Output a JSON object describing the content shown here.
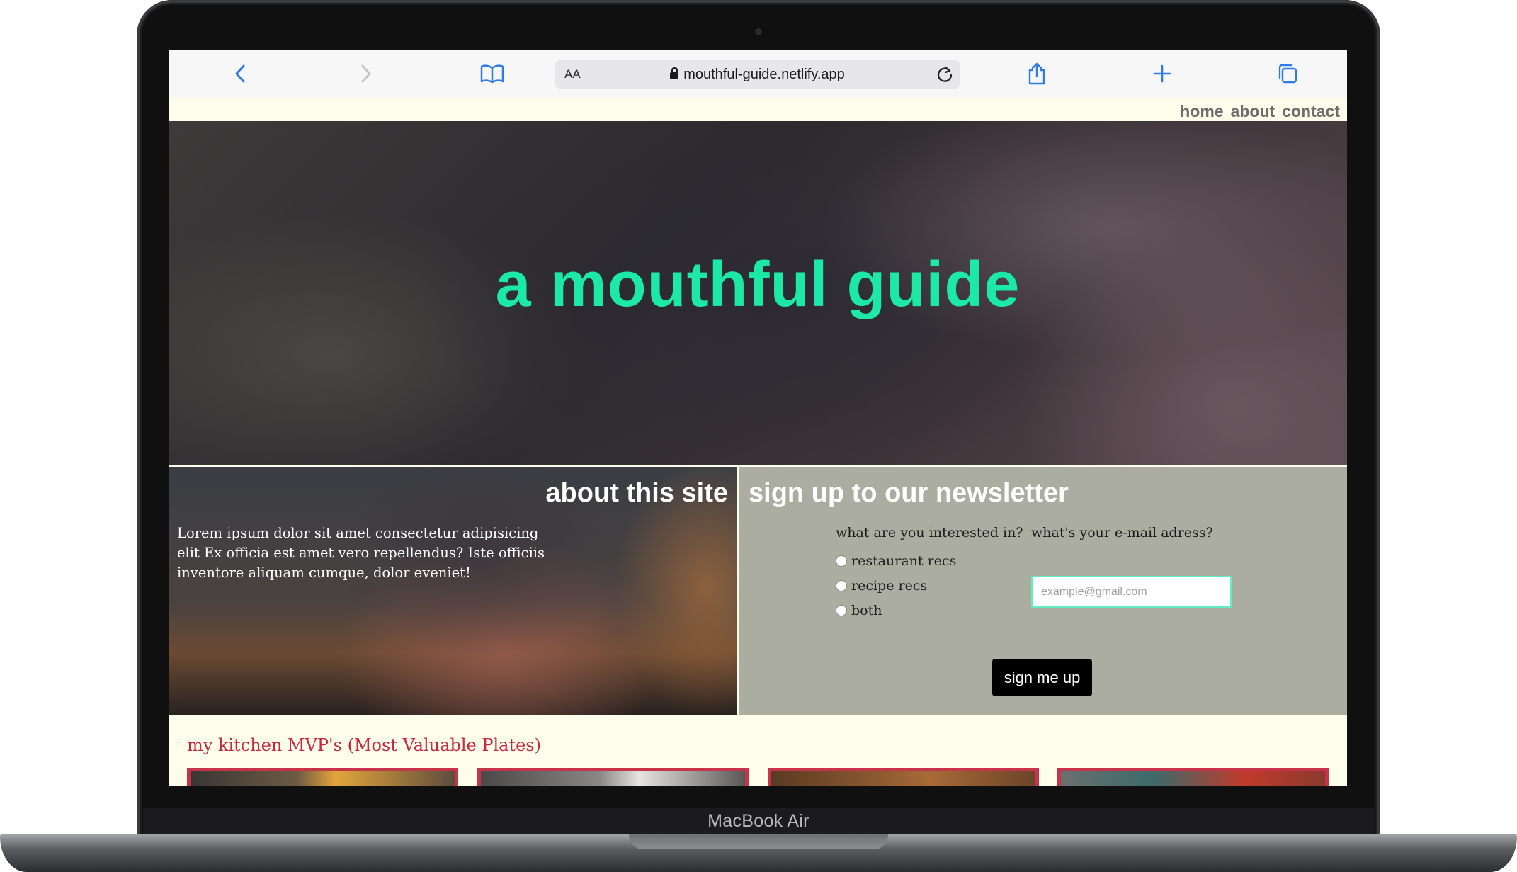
{
  "device": {
    "label": "MacBook Air"
  },
  "browser": {
    "url": "mouthful-guide.netlify.app",
    "text_size_label": "AA",
    "icons": {
      "back": "chevron-left-icon",
      "forward": "chevron-right-icon",
      "bookmarks": "book-icon",
      "reload": "reload-icon",
      "share": "share-icon",
      "new_tab": "plus-icon",
      "tabs": "tabs-icon",
      "lock": "lock-icon"
    },
    "accent_color": "#2f7bea"
  },
  "nav": {
    "items": [
      {
        "label": "home"
      },
      {
        "label": "about"
      },
      {
        "label": "contact"
      }
    ]
  },
  "hero": {
    "title": "a mouthful guide",
    "title_color": "#1de9a6"
  },
  "about": {
    "title": "about this site",
    "body": "Lorem ipsum dolor sit amet consectetur adipisicing elit Ex officia est amet vero repellendus? Iste officiis inventore aliquam cumque, dolor eveniet!"
  },
  "newsletter": {
    "title": "sign up to our newsletter",
    "interest_question": "what are you interested in?",
    "email_question": "what's your e-mail adress?",
    "options": [
      {
        "label": "restaurant recs"
      },
      {
        "label": "recipe recs"
      },
      {
        "label": "both"
      }
    ],
    "email_placeholder": "example@gmail.com",
    "email_value": "",
    "submit_label": "sign me up",
    "background": "#acada1"
  },
  "mvp": {
    "title": "my kitchen MVP's (Most Valuable Plates)",
    "card_border_color": "#c7344a",
    "cards": [
      "plate-1",
      "plate-2",
      "plate-3",
      "plate-4"
    ]
  }
}
